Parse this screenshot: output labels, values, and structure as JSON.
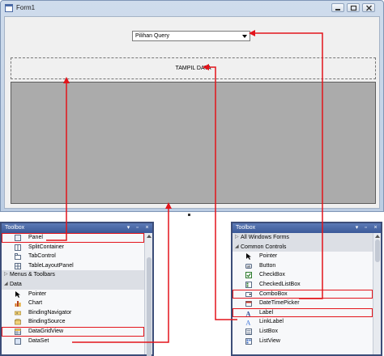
{
  "form": {
    "title": "Form1",
    "combobox_text": "Pilihan Query",
    "label_text": "TAMPIL DATA"
  },
  "toolbox_left": {
    "title": "Toolbox",
    "items": [
      {
        "label": "Panel",
        "icon": "panel-icon",
        "kind": "item",
        "highlight": true
      },
      {
        "label": "SplitContainer",
        "icon": "splitcontainer-icon",
        "kind": "item"
      },
      {
        "label": "TabControl",
        "icon": "tabcontrol-icon",
        "kind": "item"
      },
      {
        "label": "TableLayoutPanel",
        "icon": "tablelayoutpanel-icon",
        "kind": "item"
      },
      {
        "label": "Menus & Toolbars",
        "kind": "category",
        "expanded": false
      },
      {
        "label": "Data",
        "kind": "category",
        "expanded": true
      },
      {
        "label": "Pointer",
        "icon": "pointer-icon",
        "kind": "item"
      },
      {
        "label": "Chart",
        "icon": "chart-icon",
        "kind": "item"
      },
      {
        "label": "BindingNavigator",
        "icon": "bindingnavigator-icon",
        "kind": "item"
      },
      {
        "label": "BindingSource",
        "icon": "bindingsource-icon",
        "kind": "item"
      },
      {
        "label": "DataGridView",
        "icon": "datagridview-icon",
        "kind": "item",
        "highlight": true
      },
      {
        "label": "DataSet",
        "icon": "dataset-icon",
        "kind": "item"
      }
    ]
  },
  "toolbox_right": {
    "title": "Toolbox",
    "items": [
      {
        "label": "All Windows Forms",
        "kind": "category",
        "expanded": false
      },
      {
        "label": "Common Controls",
        "kind": "category",
        "expanded": true
      },
      {
        "label": "Pointer",
        "icon": "pointer-icon",
        "kind": "item"
      },
      {
        "label": "Button",
        "icon": "button-icon",
        "kind": "item"
      },
      {
        "label": "CheckBox",
        "icon": "checkbox-icon",
        "kind": "item"
      },
      {
        "label": "CheckedListBox",
        "icon": "checkedlistbox-icon",
        "kind": "item"
      },
      {
        "label": "ComboBox",
        "icon": "combobox-icon",
        "kind": "item",
        "highlight": true
      },
      {
        "label": "DateTimePicker",
        "icon": "datetimepicker-icon",
        "kind": "item"
      },
      {
        "label": "Label",
        "icon": "label-icon",
        "kind": "item",
        "highlight": true
      },
      {
        "label": "LinkLabel",
        "icon": "linklabel-icon",
        "kind": "item"
      },
      {
        "label": "ListBox",
        "icon": "listbox-icon",
        "kind": "item"
      },
      {
        "label": "ListView",
        "icon": "listview-icon",
        "kind": "item"
      }
    ]
  },
  "colors": {
    "arrow": "#e3141b",
    "grid_background": "#ababab",
    "toolbox_border": "#3c4d78"
  }
}
